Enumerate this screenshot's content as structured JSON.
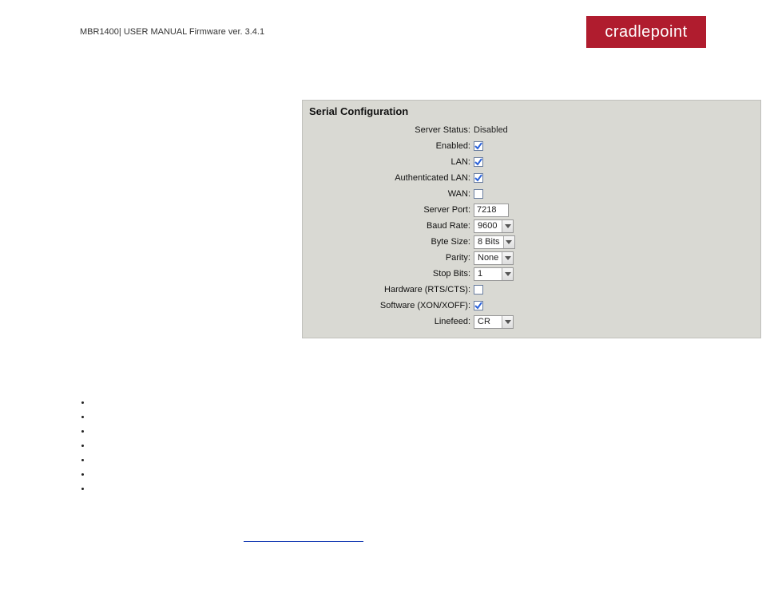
{
  "header": {
    "doc_title": "MBR1400| USER MANUAL Firmware ver. 3.4.1",
    "brand": "cradlepoint"
  },
  "panel": {
    "title": "Serial Configuration",
    "rows": [
      {
        "label": "Server Status:",
        "type": "text",
        "value": "Disabled"
      },
      {
        "label": "Enabled:",
        "type": "checkbox",
        "checked": true
      },
      {
        "label": "LAN:",
        "type": "checkbox",
        "checked": true
      },
      {
        "label": "Authenticated LAN:",
        "type": "checkbox",
        "checked": true
      },
      {
        "label": "WAN:",
        "type": "checkbox",
        "checked": false
      },
      {
        "label": "Server Port:",
        "type": "input",
        "value": "7218"
      },
      {
        "label": "Baud Rate:",
        "type": "select",
        "value": "9600"
      },
      {
        "label": "Byte Size:",
        "type": "select",
        "value": "8 Bits"
      },
      {
        "label": "Parity:",
        "type": "select",
        "value": "None"
      },
      {
        "label": "Stop Bits:",
        "type": "select",
        "value": "1"
      },
      {
        "label": "Hardware (RTS/CTS):",
        "type": "checkbox",
        "checked": false
      },
      {
        "label": "Software (XON/XOFF):",
        "type": "checkbox",
        "checked": true
      },
      {
        "label": "Linefeed:",
        "type": "select",
        "value": "CR"
      }
    ]
  },
  "bullets": [
    "",
    "",
    "",
    "",
    "",
    "",
    ""
  ],
  "colors": {
    "brand": "#b01c2e",
    "panel_bg": "#d9d9d3",
    "check": "#2b62d9"
  }
}
